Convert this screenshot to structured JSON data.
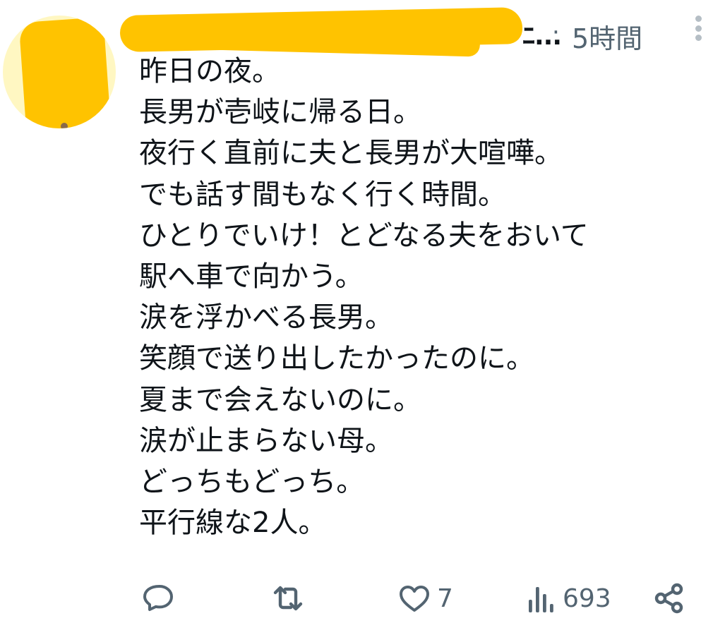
{
  "header": {
    "handle_tail": "ﾆ...",
    "separator": "·",
    "time": "5時間"
  },
  "body_lines": [
    "昨日の夜。",
    "長男が壱岐に帰る日。",
    "夜行く直前に夫と長男が大喧嘩。",
    "でも話す間もなく行く時間。",
    "ひとりでいけ！とどなる夫をおいて",
    "駅へ車で向かう。",
    "涙を浮かべる長男。",
    "笑顔で送り出したかったのに。",
    "夏まで会えないのに。",
    "涙が止まらない母。",
    "どっちもどっち。",
    "平行線な2人。"
  ],
  "actions": {
    "reply_icon": "reply-icon",
    "retweet_icon": "retweet-icon",
    "like_icon": "heart-icon",
    "like_count": "7",
    "views_icon": "views-chart-icon",
    "views_count": "693",
    "share_icon": "share-icon"
  },
  "colors": {
    "text": "#0f1419",
    "secondary": "#536471",
    "redaction": "#ffc300"
  }
}
